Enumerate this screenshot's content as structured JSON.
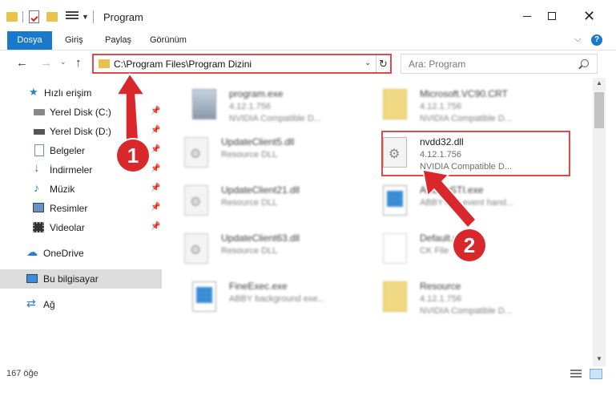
{
  "window": {
    "title": "Program",
    "minimize_icon": "minimize-icon",
    "maximize_icon": "maximize-icon",
    "close_glyph": "✕"
  },
  "ribbon": {
    "tabs": [
      "Dosya",
      "Giriş",
      "Paylaş",
      "Görünüm"
    ],
    "chevron": "⌵",
    "help": "?",
    "accent": "#1979ca"
  },
  "nav": {
    "back": "←",
    "forward": "→",
    "recent": "⌄",
    "up": "↑",
    "address": "C:\\Program Files\\Program Dizini",
    "address_dropdown": "⌄",
    "refresh": "↻",
    "search_placeholder": "Ara: Program"
  },
  "sidebar": {
    "items": [
      {
        "label": "Hızlı erişim",
        "icon": "star-icon",
        "glyph": "★"
      },
      {
        "label": "Yerel Disk (C:)",
        "icon": "disk-icon",
        "pinned": true
      },
      {
        "label": "Yerel Disk (D:)",
        "icon": "disk-icon",
        "pinned": true
      },
      {
        "label": "Belgeler",
        "icon": "documents-icon",
        "pinned": true
      },
      {
        "label": "İndirmeler",
        "icon": "download-icon",
        "glyph": "↓",
        "pinned": true
      },
      {
        "label": "Müzik",
        "icon": "music-icon",
        "glyph": "♪",
        "pinned": true
      },
      {
        "label": "Resimler",
        "icon": "pictures-icon",
        "pinned": true
      },
      {
        "label": "Videolar",
        "icon": "videos-icon",
        "pinned": true
      },
      {
        "label": "OneDrive",
        "icon": "cloud-icon",
        "glyph": "☁"
      },
      {
        "label": "Bu bilgisayar",
        "icon": "computer-icon",
        "selected": true
      },
      {
        "label": "Ağ",
        "icon": "network-icon",
        "glyph": "⇄"
      }
    ],
    "pin_glyph": "📌"
  },
  "files": [
    {
      "name": "program.exe",
      "version": "4.12.1.756",
      "desc": "NVIDIA Compatible D...",
      "icon": "exe-icon",
      "blurred": true
    },
    {
      "name": "Microsoft.VC90.CRT",
      "version": "4.12.1.756",
      "desc": "NVIDIA Compatible D...",
      "icon": "folder-icon",
      "blurred": true
    },
    {
      "name": "UpdateClient5.dll",
      "version": "Resource DLL",
      "desc": "",
      "icon": "dll-icon",
      "blurred": true
    },
    {
      "name": "nvdd32.dll",
      "version": "4.12.1.756",
      "desc": "NVIDIA Compatible D...",
      "icon": "dll-icon",
      "blurred": false
    },
    {
      "name": "UpdateClient21.dll",
      "version": "Resource DLL",
      "desc": "",
      "icon": "dll-icon",
      "blurred": true
    },
    {
      "name": "ABBYySTI.exe",
      "version": "ABBYY sti event hand...",
      "desc": "",
      "icon": "app-icon",
      "blurred": true
    },
    {
      "name": "UpdateClient63.dll",
      "version": "Resource DLL",
      "desc": "",
      "icon": "dll-icon",
      "blurred": true
    },
    {
      "name": "Default.mpck",
      "version": "CK File",
      "desc": "",
      "icon": "blank-file-icon",
      "blurred": true
    },
    {
      "name": "FineExec.exe",
      "version": "ABBY background exe...",
      "desc": "",
      "icon": "app-icon",
      "blurred": true
    },
    {
      "name": "Resource",
      "version": "4.12.1.756",
      "desc": "NVIDIA Compatible D...",
      "icon": "folder-icon",
      "blurred": true
    }
  ],
  "callouts": [
    {
      "number": "1",
      "color": "#d8282c"
    },
    {
      "number": "2",
      "color": "#d8282c"
    }
  ],
  "scroll": {
    "up": "▲",
    "down": "▼"
  },
  "status": {
    "item_count": "167 öğe"
  }
}
